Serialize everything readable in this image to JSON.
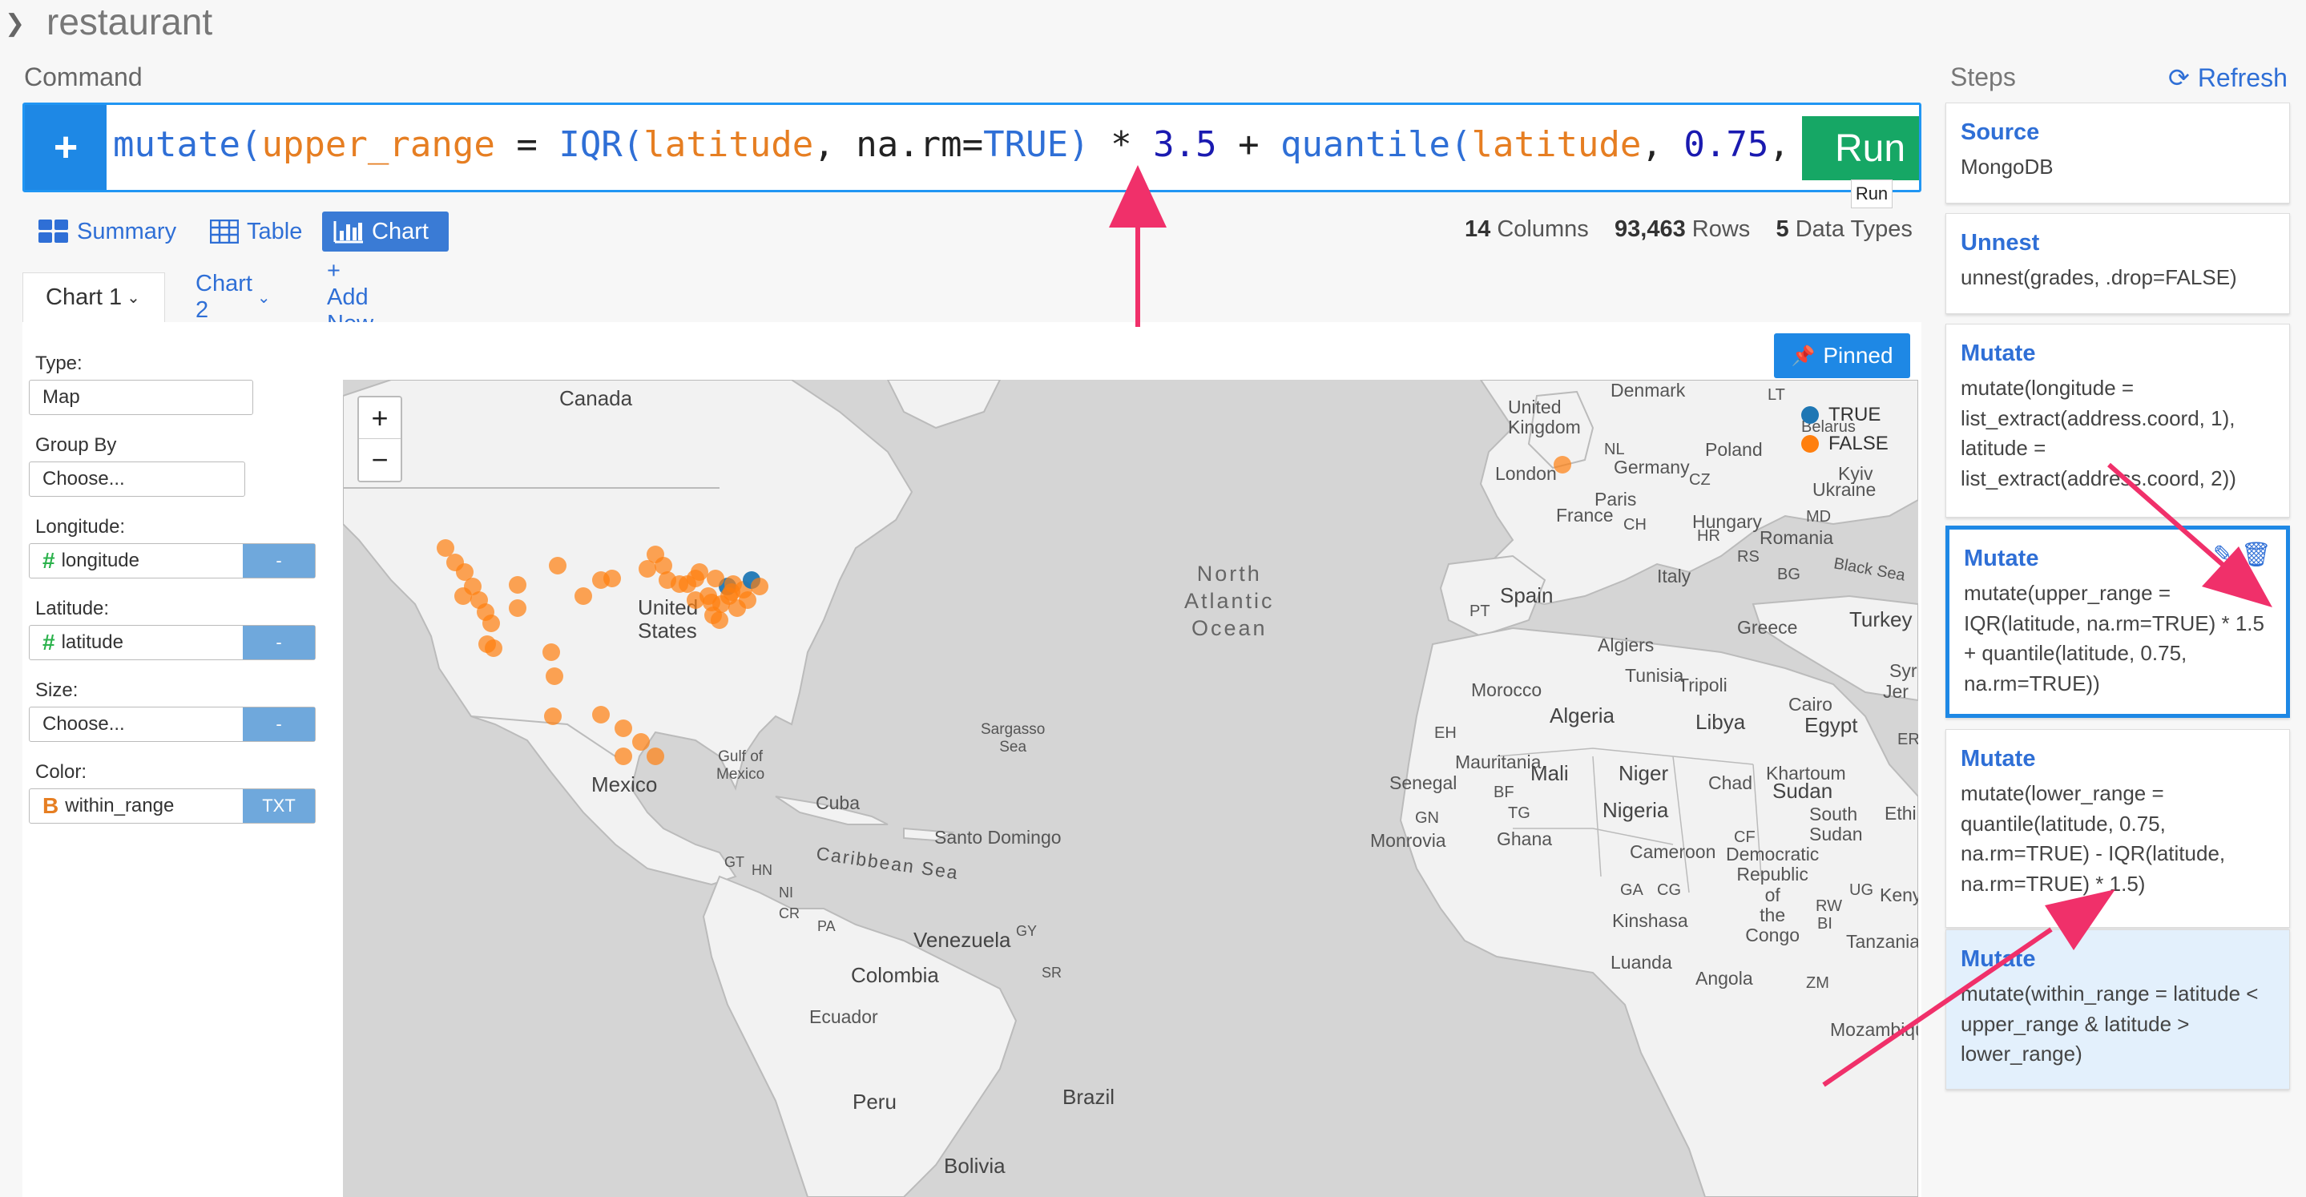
{
  "header": {
    "title": "restaurant",
    "command_label": "Command"
  },
  "command": {
    "plus": "+",
    "tokens": [
      {
        "t": "mutate(",
        "c": "kw"
      },
      {
        "t": "upper_range",
        "c": "ar"
      },
      {
        "t": " = ",
        "c": ""
      },
      {
        "t": "IQR(",
        "c": "kw"
      },
      {
        "t": "latitude",
        "c": "ar"
      },
      {
        "t": ", na.rm=",
        "c": ""
      },
      {
        "t": "TRUE",
        "c": "kw"
      },
      {
        "t": ")",
        "c": "kw"
      },
      {
        "t": " * ",
        "c": ""
      },
      {
        "t": "3.5",
        "c": "num"
      },
      {
        "t": " + ",
        "c": ""
      },
      {
        "t": "quantile(",
        "c": "kw"
      },
      {
        "t": "latitude",
        "c": "ar"
      },
      {
        "t": ", ",
        "c": ""
      },
      {
        "t": "0.75",
        "c": "num"
      },
      {
        "t": ", na.r",
        "c": ""
      }
    ],
    "run_label": "Run",
    "run_tooltip": "Run"
  },
  "view_tabs": [
    {
      "label": "Summary",
      "icon": "summary-icon"
    },
    {
      "label": "Table",
      "icon": "table-icon"
    },
    {
      "label": "Chart",
      "icon": "chart-icon",
      "active": true
    }
  ],
  "stats": {
    "columns": "14",
    "columns_label": "Columns",
    "rows": "93,463",
    "rows_label": "Rows",
    "types": "5",
    "types_label": "Data Types"
  },
  "chart_tabs": {
    "tab1": "Chart 1",
    "tab2": "Chart 2",
    "add": "+ Add New"
  },
  "config": {
    "type_label": "Type:",
    "type_value": "Map",
    "group_label": "Group By",
    "group_value": "Choose...",
    "lon_label": "Longitude:",
    "lon_value": "longitude",
    "lon_btn": "-",
    "lat_label": "Latitude:",
    "lat_value": "latitude",
    "lat_btn": "-",
    "size_label": "Size:",
    "size_value": "Choose...",
    "size_btn": "-",
    "color_label": "Color:",
    "color_value": "within_range",
    "color_btn": "TXT"
  },
  "pinned_label": "Pinned",
  "map": {
    "zoom_in": "+",
    "zoom_out": "−",
    "legend": [
      {
        "label": "TRUE",
        "color": "#1f77b4"
      },
      {
        "label": "FALSE",
        "color": "#ff7f0e"
      }
    ],
    "labels": {
      "canada": "Canada",
      "us": "United\nStates",
      "mexico": "Mexico",
      "gulf": "Gulf of\nMexico",
      "cuba": "Cuba",
      "sargasso": "Sargasso\nSea",
      "ocean": "North\nAtlantic\nOcean",
      "caribbean": "Caribbean Sea",
      "santo": "Santo Domingo",
      "venezuela": "Venezuela",
      "colombia": "Colombia",
      "ecuador": "Ecuador",
      "peru": "Peru",
      "brazil": "Brazil",
      "bolivia": "Bolivia",
      "gy": "GY",
      "sr": "SR",
      "gt": "GT",
      "hn": "HN",
      "ni": "NI",
      "cr": "CR",
      "pa": "PA",
      "uk": "United\nKingdom",
      "london": "London",
      "denmark": "Denmark",
      "nl": "NL",
      "germany": "Germany",
      "poland": "Poland",
      "paris": "Paris",
      "france": "France",
      "cz": "CZ",
      "ch": "CH",
      "hungary": "Hungary",
      "hr": "HR",
      "rs": "RS",
      "romania": "Romania",
      "md": "MD",
      "ukraine": "Ukraine",
      "kyiv": "Kyiv",
      "lt": "LT",
      "belarus": "Belarus",
      "spain": "Spain",
      "pt": "PT",
      "italy": "Italy",
      "bg": "BG",
      "greece": "Greece",
      "turkey": "Turkey",
      "black_sea": "Black Sea",
      "algiers": "Algiers",
      "tunisia": "Tunisia",
      "tripoli": "Tripoli",
      "morocco": "Morocco",
      "algeria": "Algeria",
      "libya": "Libya",
      "egypt": "Egypt",
      "cairo": "Cairo",
      "syr": "Syr",
      "jer": "Jer",
      "eh": "EH",
      "mauritania": "Mauritania",
      "mali": "Mali",
      "niger": "Niger",
      "chad": "Chad",
      "sudan": "Sudan",
      "khartoum": "Khartoum",
      "senegal": "Senegal",
      "gn": "GN",
      "bf": "BF",
      "tg": "TG",
      "nigeria": "Nigeria",
      "ghana": "Ghana",
      "monrovia": "Monrovia",
      "cameroon": "Cameroon",
      "cf": "CF",
      "south_sudan": "South\nSudan",
      "ethi": "Ethi",
      "er": "ER",
      "drc": "Democratic\nRepublic\nof\nthe\nCongo",
      "ga": "GA",
      "cg": "CG",
      "kinshasa": "Kinshasa",
      "luanda": "Luanda",
      "angola": "Angola",
      "ug": "UG",
      "keny": "Keny",
      "rw": "RW",
      "bi": "BI",
      "tanzania": "Tanzania",
      "zm": "ZM",
      "mozambique": "Mozambiqu"
    }
  },
  "steps": {
    "label": "Steps",
    "refresh": "Refresh",
    "items": [
      {
        "title": "Source",
        "desc": "MongoDB"
      },
      {
        "title": "Unnest",
        "desc": "unnest(grades, .drop=FALSE)"
      },
      {
        "title": "Mutate",
        "desc": "mutate(longitude = list_extract(address.coord, 1), latitude = list_extract(address.coord, 2))"
      },
      {
        "title": "Mutate",
        "desc": "mutate(upper_range = IQR(latitude, na.rm=TRUE) * 1.5 + quantile(latitude, 0.75, na.rm=TRUE))"
      },
      {
        "title": "Mutate",
        "desc": "mutate(lower_range = quantile(latitude, 0.75, na.rm=TRUE) - IQR(latitude, na.rm=TRUE) * 1.5)"
      },
      {
        "title": "Mutate",
        "desc": "mutate(within_range = latitude < upper_range & latitude > lower_range)"
      }
    ]
  }
}
